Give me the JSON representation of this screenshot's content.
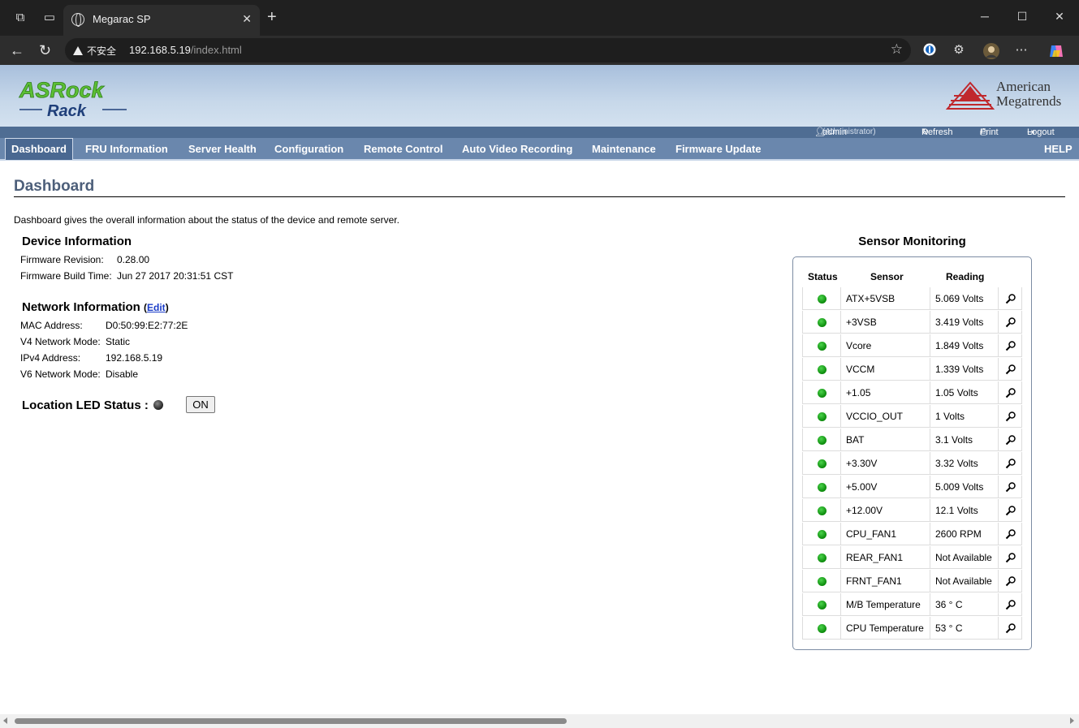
{
  "browser": {
    "tab_title": "Megarac SP",
    "security_label": "不安全",
    "url_host": "192.168.5.19",
    "url_path": "/index.html"
  },
  "header": {
    "ami_line1": "American",
    "ami_line2": "Megatrends",
    "user": "admin",
    "role": "(Administrator)",
    "refresh": "Refresh",
    "print": "Print",
    "logout": "Logout"
  },
  "menu": {
    "items": [
      "Dashboard",
      "FRU Information",
      "Server Health",
      "Configuration",
      "Remote Control",
      "Auto Video Recording",
      "Maintenance",
      "Firmware Update"
    ],
    "help": "HELP"
  },
  "page": {
    "title": "Dashboard",
    "intro": "Dashboard gives the overall information about the status of the device and remote server."
  },
  "device": {
    "heading": "Device Information",
    "fw_rev_label": "Firmware Revision:",
    "fw_rev_value": "0.28.00",
    "fw_build_label": "Firmware Build Time:",
    "fw_build_value": "Jun 27 2017 20:31:51 CST"
  },
  "network": {
    "heading": "Network Information",
    "edit_prefix": "(",
    "edit": "Edit",
    "edit_suffix": ")",
    "mac_label": "MAC Address:",
    "mac_value": "D0:50:99:E2:77:2E",
    "v4mode_label": "V4 Network Mode:",
    "v4mode_value": "Static",
    "ipv4_label": "IPv4 Address:",
    "ipv4_value": "192.168.5.19",
    "v6mode_label": "V6 Network Mode:",
    "v6mode_value": "Disable"
  },
  "led": {
    "label": "Location LED Status :",
    "button": "ON"
  },
  "sensors": {
    "title": "Sensor Monitoring",
    "headers": [
      "Status",
      "Sensor",
      "Reading"
    ],
    "rows": [
      {
        "sensor": "ATX+5VSB",
        "reading": "5.069 Volts"
      },
      {
        "sensor": "+3VSB",
        "reading": "3.419 Volts"
      },
      {
        "sensor": "Vcore",
        "reading": "1.849 Volts"
      },
      {
        "sensor": "VCCM",
        "reading": "1.339 Volts"
      },
      {
        "sensor": "+1.05",
        "reading": "1.05 Volts"
      },
      {
        "sensor": "VCCIO_OUT",
        "reading": "1 Volts"
      },
      {
        "sensor": "BAT",
        "reading": "3.1 Volts"
      },
      {
        "sensor": "+3.30V",
        "reading": "3.32 Volts"
      },
      {
        "sensor": "+5.00V",
        "reading": "5.009 Volts"
      },
      {
        "sensor": "+12.00V",
        "reading": "12.1 Volts"
      },
      {
        "sensor": "CPU_FAN1",
        "reading": "2600 RPM"
      },
      {
        "sensor": "REAR_FAN1",
        "reading": "Not Available"
      },
      {
        "sensor": "FRNT_FAN1",
        "reading": "Not Available"
      },
      {
        "sensor": "M/B Temperature",
        "reading": "36 ° C"
      },
      {
        "sensor": "CPU Temperature",
        "reading": "53 ° C"
      }
    ]
  },
  "colors": {
    "menu_bg": "#6a87ad",
    "status_ok": "#17a017",
    "title_color": "#4d5f7a"
  }
}
